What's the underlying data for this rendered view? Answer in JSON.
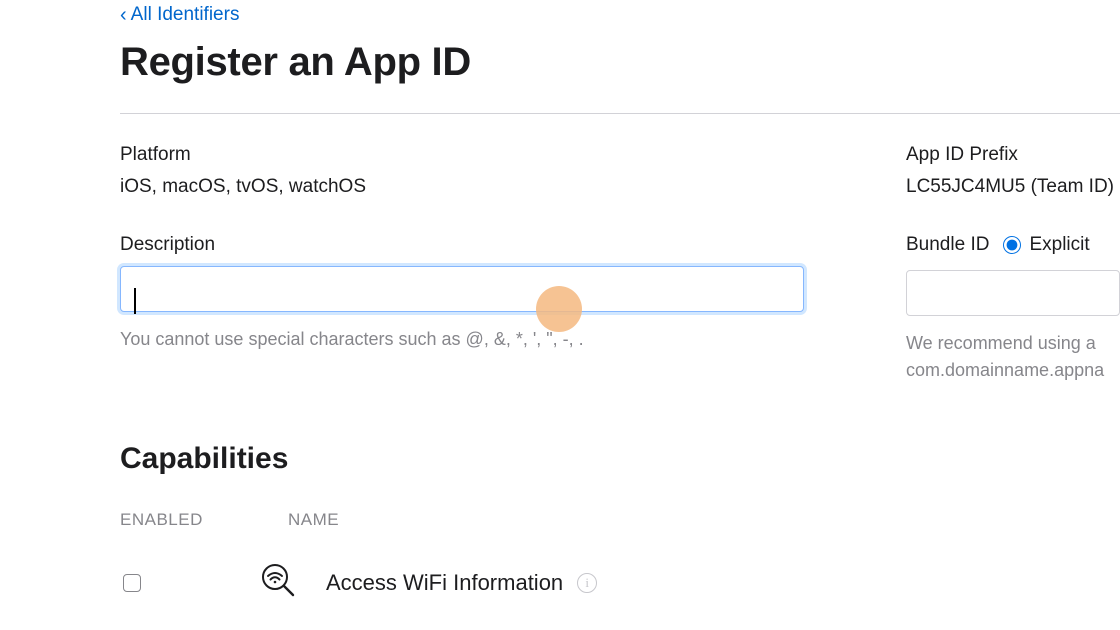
{
  "nav": {
    "back_label": "All Identifiers"
  },
  "header": {
    "title": "Register an App ID"
  },
  "form": {
    "platform": {
      "label": "Platform",
      "value": "iOS, macOS, tvOS, watchOS"
    },
    "prefix": {
      "label": "App ID Prefix",
      "value": "LC55JC4MU5 (Team ID)"
    },
    "description": {
      "label": "Description",
      "value": "",
      "help": "You cannot use special characters such as @, &, *, ', \", -, ."
    },
    "bundle": {
      "label": "Bundle ID",
      "explicit_label": "Explicit",
      "help_line1": "We recommend using a",
      "help_line2": "com.domainname.appna"
    }
  },
  "capabilities": {
    "title": "Capabilities",
    "columns": {
      "enabled": "ENABLED",
      "name": "NAME"
    },
    "rows": [
      {
        "enabled": false,
        "icon": "wifi-search",
        "name": "Access WiFi Information"
      }
    ]
  }
}
